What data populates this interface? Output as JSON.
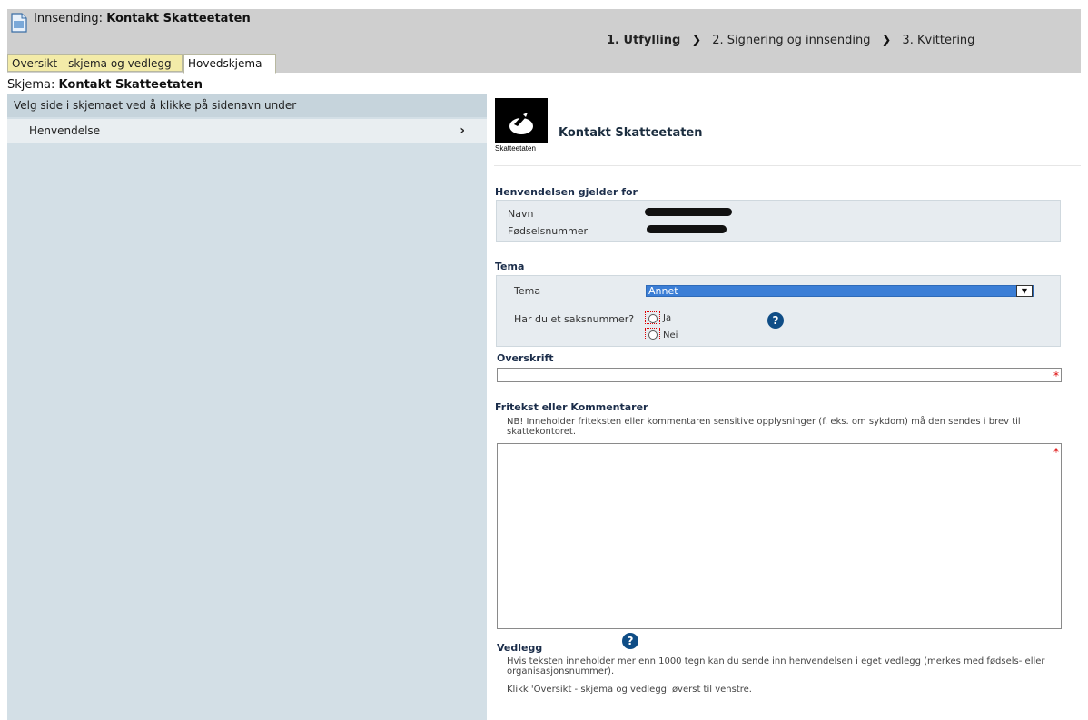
{
  "header": {
    "title_prefix": "Innsending: ",
    "title_name": "Kontakt Skatteetaten",
    "steps": [
      "1. Utfylling",
      "2. Signering og innsending",
      "3. Kvittering"
    ]
  },
  "tabs": {
    "overview": "Oversikt - skjema og vedlegg",
    "main": "Hovedskjema"
  },
  "schema": {
    "prefix": "Skjema: ",
    "name": "Kontakt Skatteetaten"
  },
  "sidebar": {
    "heading": "Velg side i skjemaet ved å klikke på sidenavn under",
    "items": [
      {
        "label": "Henvendelse",
        "arrow": "›"
      }
    ]
  },
  "form": {
    "logo_text": "Skatteetaten",
    "title": "Kontakt Skatteetaten",
    "section_person": "Henvendelsen gjelder for",
    "label_name": "Navn",
    "label_ssn": "Fødselsnummer",
    "section_tema": "Tema",
    "label_tema": "Tema",
    "tema_selected": "Annet",
    "label_case": "Har du et saksnummer?",
    "option_yes": "Ja",
    "option_no": "Nei",
    "section_heading": "Overskrift",
    "section_freetext": "Fritekst eller Kommentarer",
    "freetext_note": "NB! Inneholder friteksten eller kommentaren sensitive opplysninger (f. eks. om sykdom) må den sendes i brev til skattekontoret.",
    "section_attachment": "Vedlegg",
    "attachment_note_1": "Hvis teksten inneholder mer enn 1000 tegn kan du sende inn henvendelsen i eget vedlegg (merkes med fødsels- eller organisasjonsnummer).",
    "attachment_note_2": "Klikk 'Oversikt - skjema og vedlegg' øverst til venstre.",
    "required_mark": "*",
    "help_glyph": "?"
  },
  "colors": {
    "header_bg": "#cfcfcf",
    "overview_tab_bg": "#f3eba8",
    "sidebar_bg": "#d3dfe6",
    "panel_bg": "#e7ecf0",
    "select_bg": "#3b7ed6",
    "help_icon": "#0f4d86",
    "required": "#dd0000"
  },
  "icons": {
    "document": "document-icon",
    "step_separator": "chevron-right-icon",
    "dropdown": "chevron-down-icon",
    "help": "help-icon"
  }
}
